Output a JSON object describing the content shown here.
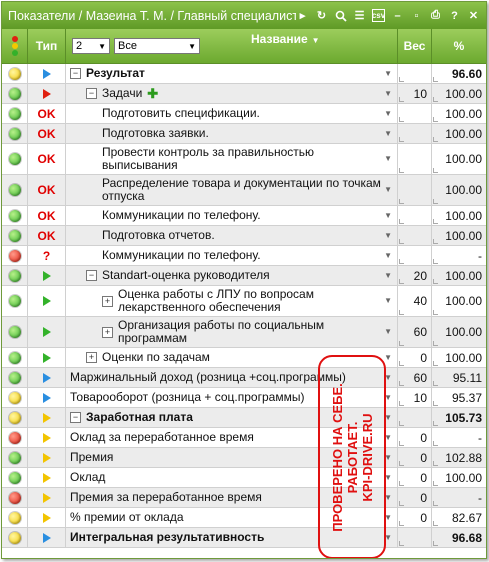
{
  "window": {
    "title": "Показатели / Мазеина Т. М. / Главный специалист-",
    "icons": [
      "arrow-right-icon",
      "refresh-icon",
      "search-icon",
      "list-icon",
      "csv-icon",
      "minimize-icon",
      "restore-icon",
      "print-icon",
      "help-icon",
      "close-icon"
    ],
    "csv_label": "csv",
    "help_label": "?",
    "close_label": "✕"
  },
  "header": {
    "type_label": "Тип",
    "level_value": "2",
    "filter_value": "Все",
    "name_label": "Название",
    "weight_label": "Вес",
    "percent_label": "%"
  },
  "colors": {
    "header_green": "#6ca92f",
    "stamp_red": "#e01010",
    "ok_red": "#e00000"
  },
  "rows": [
    {
      "light": "yellow",
      "type": "tri-blue",
      "type_text": "",
      "indent": 0,
      "expander": "−",
      "name": "Результат",
      "bold": true,
      "dropdown": true,
      "weight": "",
      "percent": "96.60",
      "alt": false
    },
    {
      "light": "green",
      "type": "tri-red",
      "type_text": "",
      "indent": 1,
      "expander": "−",
      "name": "Задачи",
      "bold": false,
      "plus": true,
      "dropdown": true,
      "weight": "10",
      "percent": "100.00",
      "alt": true
    },
    {
      "light": "green",
      "type": "text",
      "type_text": "OK",
      "indent": 2,
      "expander": "",
      "name": "Подготовить спецификации.",
      "dropdown": true,
      "weight": "",
      "percent": "100.00",
      "alt": false
    },
    {
      "light": "green",
      "type": "text",
      "type_text": "OK",
      "indent": 2,
      "expander": "",
      "name": "Подготовка заявки.",
      "dropdown": true,
      "weight": "",
      "percent": "100.00",
      "alt": true
    },
    {
      "light": "green",
      "type": "text",
      "type_text": "OK",
      "indent": 2,
      "expander": "",
      "name": "Провести контроль за правильностью выписывания",
      "dropdown": true,
      "weight": "",
      "percent": "100.00",
      "alt": false,
      "tall": true
    },
    {
      "light": "green",
      "type": "text",
      "type_text": "OK",
      "indent": 2,
      "expander": "",
      "name": "Распределение товара и документации по точкам отпуска",
      "dropdown": true,
      "weight": "",
      "percent": "100.00",
      "alt": true,
      "tall": true
    },
    {
      "light": "green",
      "type": "text",
      "type_text": "OK",
      "indent": 2,
      "expander": "",
      "name": "Коммуникации по телефону.",
      "dropdown": true,
      "weight": "",
      "percent": "100.00",
      "alt": false
    },
    {
      "light": "green",
      "type": "text",
      "type_text": "OK",
      "indent": 2,
      "expander": "",
      "name": "Подготовка отчетов.",
      "dropdown": true,
      "weight": "",
      "percent": "100.00",
      "alt": true
    },
    {
      "light": "red",
      "type": "text",
      "type_text": "?",
      "indent": 2,
      "expander": "",
      "name": "Коммуникации по телефону.",
      "dropdown": true,
      "weight": "",
      "percent": "-",
      "alt": false
    },
    {
      "light": "green",
      "type": "tri-green",
      "type_text": "",
      "indent": 1,
      "expander": "−",
      "name": "Standart-оценка руководителя",
      "dropdown": true,
      "weight": "20",
      "percent": "100.00",
      "alt": true
    },
    {
      "light": "green",
      "type": "tri-green",
      "type_text": "",
      "indent": 2,
      "expander": "+",
      "name": "Оценка работы с ЛПУ по вопросам лекарственного обеспечения",
      "dropdown": true,
      "weight": "40",
      "percent": "100.00",
      "alt": false,
      "tall": true
    },
    {
      "light": "green",
      "type": "tri-green",
      "type_text": "",
      "indent": 2,
      "expander": "+",
      "name": "Организация работы по социальным программам",
      "dropdown": true,
      "weight": "60",
      "percent": "100.00",
      "alt": true,
      "tall": true
    },
    {
      "light": "green",
      "type": "tri-green",
      "type_text": "",
      "indent": 1,
      "expander": "+",
      "name": "Оценки по задачам",
      "dropdown": true,
      "weight": "0",
      "percent": "100.00",
      "alt": false
    },
    {
      "light": "green",
      "type": "tri-blue",
      "type_text": "",
      "indent": 0,
      "expander": "",
      "name": "Маржинальный доход (розница +соц.программы)",
      "dropdown": true,
      "weight": "60",
      "percent": "95.11",
      "alt": true
    },
    {
      "light": "yellow",
      "type": "tri-blue",
      "type_text": "",
      "indent": 0,
      "expander": "",
      "name": "Товарооборот (розница + соц.программы)",
      "dropdown": true,
      "weight": "10",
      "percent": "95.37",
      "alt": false
    },
    {
      "light": "yellow",
      "type": "tri-yellow",
      "type_text": "",
      "indent": 0,
      "expander": "−",
      "name": "Заработная плата",
      "bold": true,
      "dropdown": true,
      "weight": "",
      "percent": "105.73",
      "alt": true
    },
    {
      "light": "red",
      "type": "tri-yellow",
      "type_text": "",
      "indent": 0,
      "expander": "",
      "name": "Оклад за переработанное время",
      "dropdown": true,
      "weight": "0",
      "percent": "-",
      "alt": false
    },
    {
      "light": "green",
      "type": "tri-yellow",
      "type_text": "",
      "indent": 0,
      "expander": "",
      "name": "Премия",
      "dropdown": true,
      "weight": "0",
      "percent": "102.88",
      "alt": true
    },
    {
      "light": "green",
      "type": "tri-yellow",
      "type_text": "",
      "indent": 0,
      "expander": "",
      "name": "Оклад",
      "dropdown": true,
      "weight": "0",
      "percent": "100.00",
      "alt": false
    },
    {
      "light": "red",
      "type": "tri-yellow",
      "type_text": "",
      "indent": 0,
      "expander": "",
      "name": "Премия за переработанное время",
      "dropdown": true,
      "weight": "0",
      "percent": "-",
      "alt": true
    },
    {
      "light": "yellow",
      "type": "tri-yellow",
      "type_text": "",
      "indent": 0,
      "expander": "",
      "name": "% премии от оклада",
      "dropdown": true,
      "weight": "0",
      "percent": "82.67",
      "alt": false
    },
    {
      "light": "yellow",
      "type": "tri-blue",
      "type_text": "",
      "indent": 0,
      "expander": "",
      "name": "Интегральная результативность",
      "bold": true,
      "dropdown": true,
      "weight": "",
      "percent": "96.68",
      "alt": true
    }
  ],
  "stamp": {
    "lines": [
      "ПРОВЕРЕНО НА СЕБЕ.",
      "РАБОТАЕТ.",
      "KPI-DRIVE.RU"
    ]
  }
}
